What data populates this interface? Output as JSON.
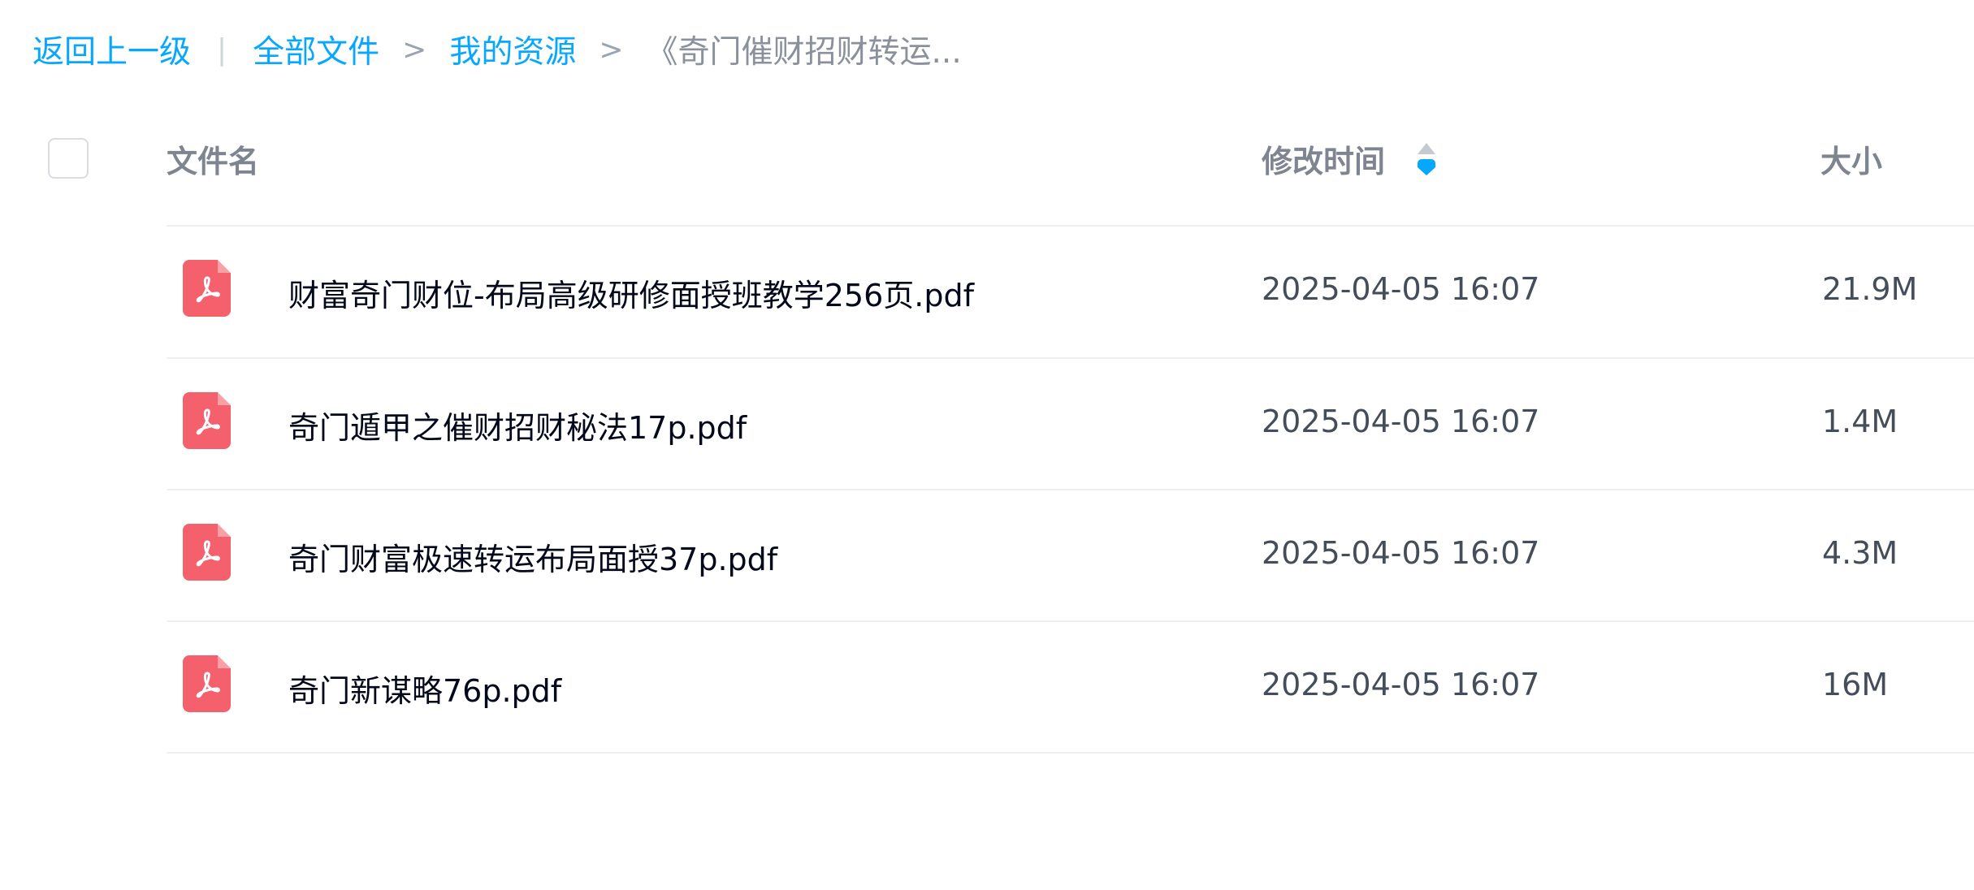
{
  "breadcrumb": {
    "back": "返回上一级",
    "pipe": "|",
    "all_files": "全部文件",
    "sep1": ">",
    "my_resources": "我的资源",
    "sep2": ">",
    "current": "《奇门催财招财转运..."
  },
  "table": {
    "columns": {
      "name": "文件名",
      "modified": "修改时间",
      "size": "大小"
    },
    "sort": {
      "column": "modified",
      "direction": "descending"
    },
    "rows": [
      {
        "icon": "pdf-icon",
        "name": "财富奇门财位-布局高级研修面授班教学256页.pdf",
        "modified": "2025-04-05 16:07",
        "size": "21.9M"
      },
      {
        "icon": "pdf-icon",
        "name": "奇门遁甲之催财招财秘法17p.pdf",
        "modified": "2025-04-05 16:07",
        "size": "1.4M"
      },
      {
        "icon": "pdf-icon",
        "name": "奇门财富极速转运布局面授37p.pdf",
        "modified": "2025-04-05 16:07",
        "size": "4.3M"
      },
      {
        "icon": "pdf-icon",
        "name": "奇门新谋略76p.pdf",
        "modified": "2025-04-05 16:07",
        "size": "16M"
      }
    ]
  },
  "colors": {
    "link": "#06a7ff",
    "pdf_icon": "#f4606c",
    "sort_active": "#06a7ff"
  }
}
